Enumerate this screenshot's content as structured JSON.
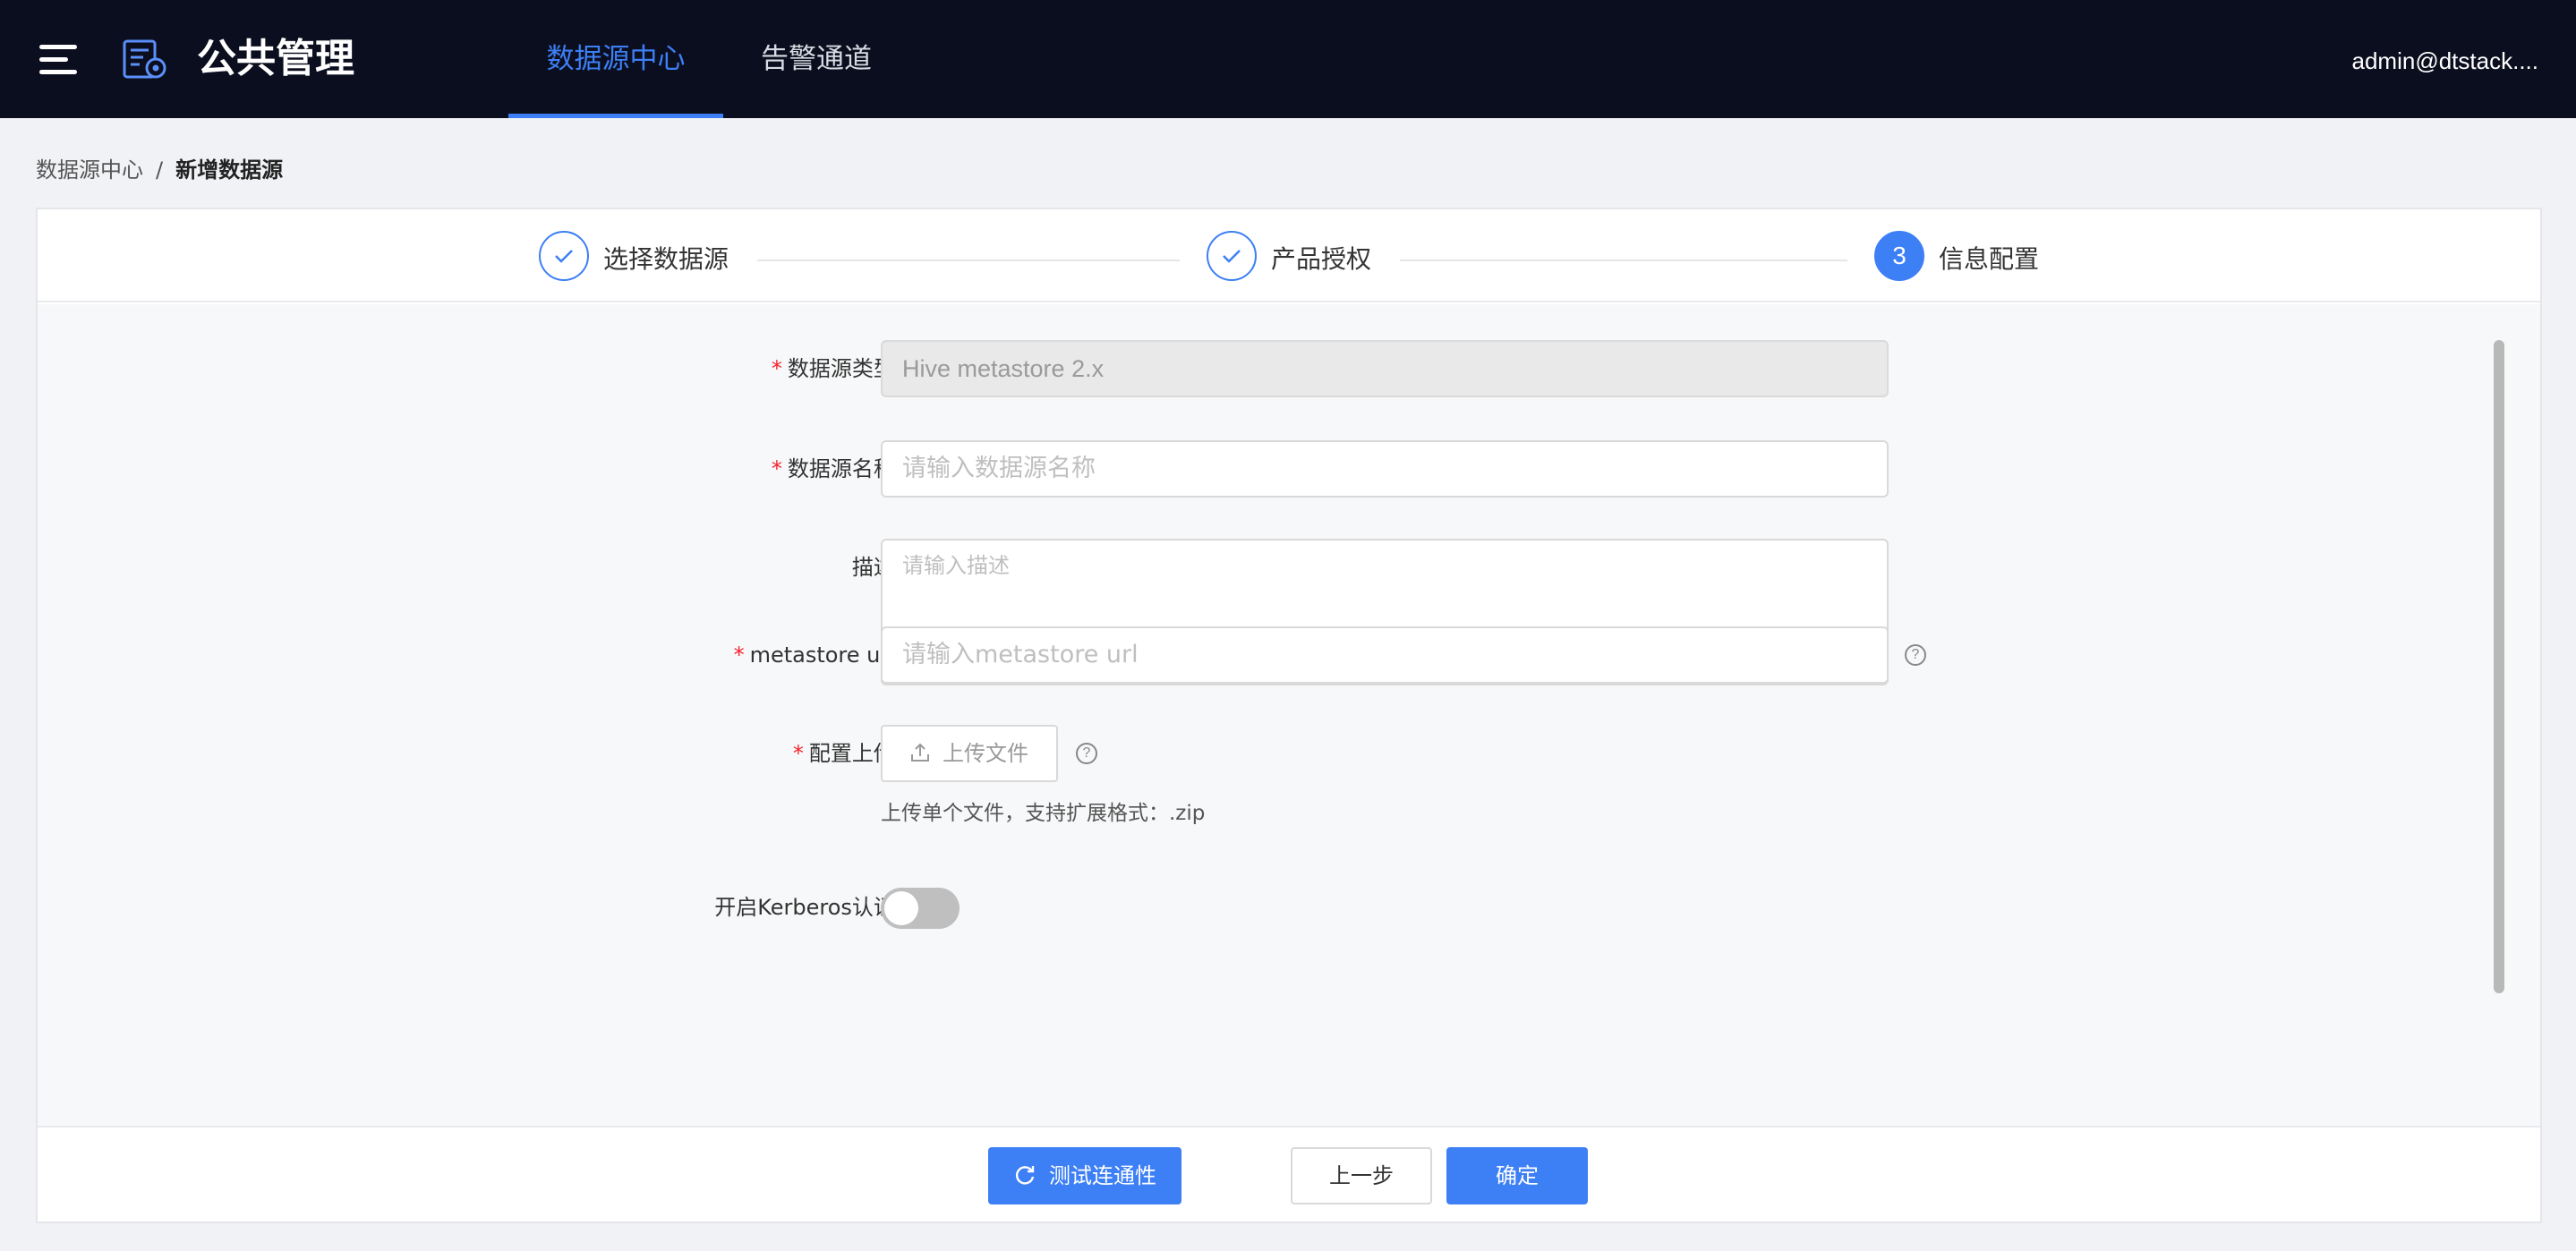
{
  "header": {
    "title": "公共管理",
    "nav": [
      {
        "label": "数据源中心",
        "active": true
      },
      {
        "label": "告警通道",
        "active": false
      }
    ],
    "user": "admin@dtstack...."
  },
  "breadcrumb": {
    "parent": "数据源中心",
    "separator": "/",
    "current": "新增数据源"
  },
  "steps": [
    {
      "label": "选择数据源",
      "status": "done"
    },
    {
      "label": "产品授权",
      "status": "done"
    },
    {
      "label": "信息配置",
      "status": "current",
      "number": "3"
    }
  ],
  "form": {
    "type": {
      "label": "数据源类型:",
      "required": true,
      "value": "Hive metastore 2.x"
    },
    "name": {
      "label": "数据源名称:",
      "required": true,
      "placeholder": "请输入数据源名称"
    },
    "desc": {
      "label": "描述:",
      "required": false,
      "placeholder": "请输入描述"
    },
    "metastore": {
      "label": "metastore url:",
      "required": true,
      "placeholder": "请输入metastore url"
    },
    "upload": {
      "label": "配置上传:",
      "required": true,
      "button": "上传文件",
      "hint": "上传单个文件，支持扩展格式：.zip"
    },
    "kerberos": {
      "label": "开启Kerberos认证:",
      "enabled": false
    }
  },
  "footer": {
    "test_label": "测试连通性",
    "prev_label": "上一步",
    "ok_label": "确定"
  },
  "colors": {
    "accent": "#3d7ff5",
    "header_bg": "#0b0e1e",
    "required": "#f5222d"
  }
}
